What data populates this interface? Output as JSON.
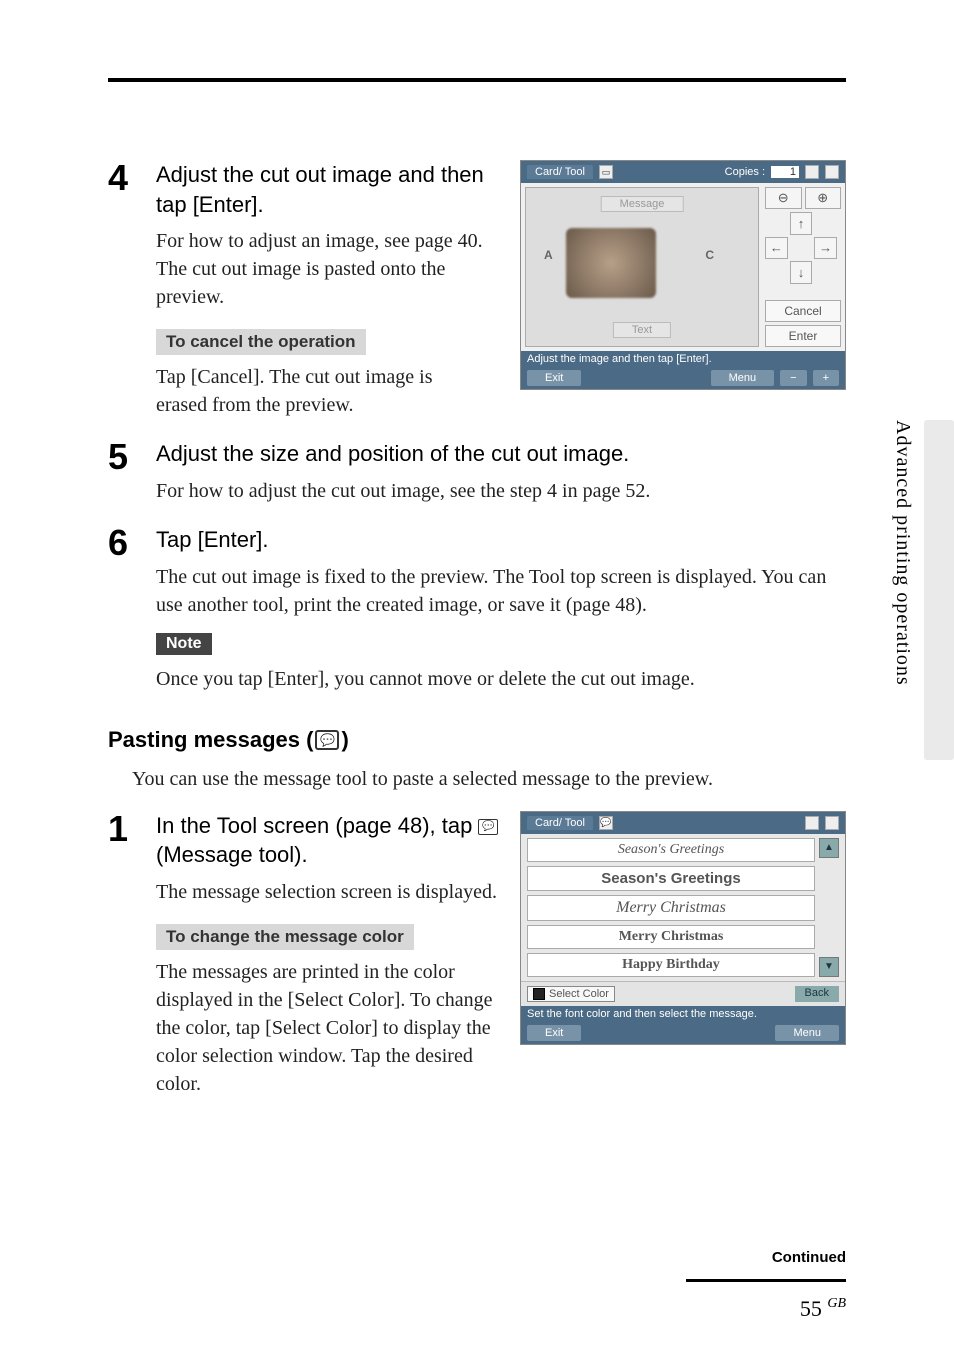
{
  "steps": {
    "s4": {
      "num": "4",
      "title": "Adjust the cut out image and then tap [Enter].",
      "text": "For how to adjust an image, see page 40.  The cut out image is pasted onto the preview.",
      "cancel_heading": "To cancel the operation",
      "cancel_text": "Tap [Cancel].  The cut out image is erased from the preview."
    },
    "s5": {
      "num": "5",
      "title": "Adjust the size and position of the cut out image.",
      "text": "For how to adjust the cut out image, see the step 4 in page 52."
    },
    "s6": {
      "num": "6",
      "title": "Tap [Enter].",
      "text": "The cut out image is fixed to the preview.  The Tool top screen is displayed.  You can use another tool, print the created image, or save it (page 48).",
      "note_label": "Note",
      "note_text": "Once you tap [Enter], you cannot move or delete the cut out image."
    }
  },
  "section": {
    "heading_prefix": "Pasting messages (",
    "heading_suffix": ")",
    "intro": "You can use the message tool to paste a selected message to the preview."
  },
  "msg_steps": {
    "s1": {
      "num": "1",
      "title_a": "In the Tool screen (page 48), tap ",
      "title_b": " (Message tool).",
      "text": "The message selection screen is displayed.",
      "change_heading": "To change the message color",
      "change_text": "The messages are printed in the color displayed in the [Select Color].  To change the color, tap [Select Color] to display the color selection window.  Tap the desired color."
    }
  },
  "fig1": {
    "tab1": "Card",
    "tab2": "Tool",
    "copies_label": "Copies :",
    "copies_value": "1",
    "message_tag": "Message",
    "text_tag": "Text",
    "markerA": "A",
    "markerC": "C",
    "cancel": "Cancel",
    "enter": "Enter",
    "status": "Adjust the image and then tap [Enter].",
    "exit": "Exit",
    "menu": "Menu",
    "minus": "−",
    "plus": "+",
    "zoom_out": "⊖",
    "zoom_in": "⊕",
    "up": "↑",
    "down": "↓",
    "left": "←",
    "right": "→"
  },
  "fig2": {
    "tab1": "Card",
    "tab2": "Tool",
    "items": [
      "Season's Greetings",
      "Season's Greetings",
      "Merry Christmas",
      "Merry Christmas",
      "Happy Birthday"
    ],
    "select_color": "Select Color",
    "back": "Back",
    "status": "Set the font color and then select the message.",
    "exit": "Exit",
    "menu": "Menu",
    "up": "▲",
    "down": "▼"
  },
  "side_label": "Advanced printing operations",
  "continued": "Continued",
  "page": "55",
  "page_suffix": "GB"
}
